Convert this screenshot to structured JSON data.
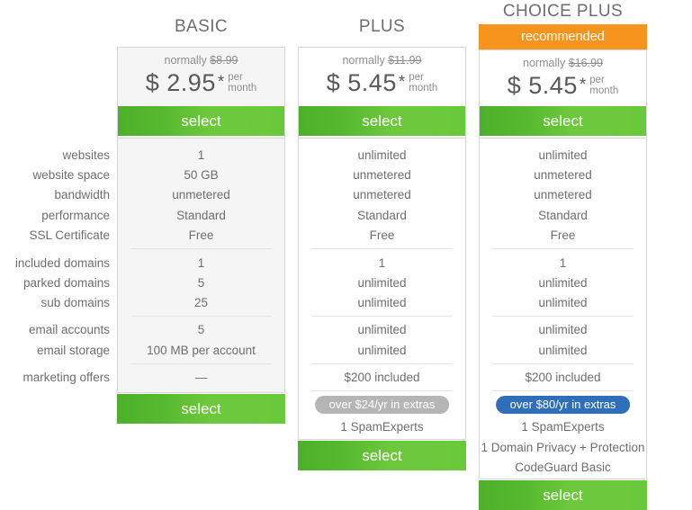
{
  "feature_labels": [
    "websites",
    "website space",
    "bandwidth",
    "performance",
    "SSL Certificate",
    "included domains",
    "parked domains",
    "sub domains",
    "email accounts",
    "email storage",
    "marketing offers"
  ],
  "colors": {
    "green_button": "#5cbf33",
    "recommended_orange": "#f7941e",
    "pill_gray": "#b5b5b5",
    "pill_blue": "#2f6fba",
    "text": "#6d6e71",
    "card_border": "#d5d6d7",
    "basic_background": "#f5f5f5"
  },
  "plans": {
    "basic": {
      "title": "BASIC",
      "ribbon": "",
      "normally_prefix": "normally ",
      "normally_price": "$8.99",
      "price": "$ 2.95",
      "star": "*",
      "per": "per",
      "month": "month",
      "select_label": "select",
      "features": [
        "1",
        "50 GB",
        "unmetered",
        "Standard",
        "Free",
        "1",
        "5",
        "25",
        "5",
        "100 MB per account",
        "—"
      ],
      "extras_pill": "",
      "extras": []
    },
    "plus": {
      "title": "PLUS",
      "ribbon": "",
      "normally_prefix": "normally ",
      "normally_price": "$11.99",
      "price": "$ 5.45",
      "star": "*",
      "per": "per",
      "month": "month",
      "select_label": "select",
      "features": [
        "unlimited",
        "unmetered",
        "unmetered",
        "Standard",
        "Free",
        "1",
        "unlimited",
        "unlimited",
        "unlimited",
        "unlimited",
        "$200 included"
      ],
      "extras_pill": "over $24/yr in extras",
      "extras": [
        "1 SpamExperts"
      ]
    },
    "choice_plus": {
      "title": "CHOICE PLUS",
      "ribbon": "recommended",
      "normally_prefix": "normally ",
      "normally_price": "$16.99",
      "price": "$ 5.45",
      "star": "*",
      "per": "per",
      "month": "month",
      "select_label": "select",
      "features": [
        "unlimited",
        "unmetered",
        "unmetered",
        "Standard",
        "Free",
        "1",
        "unlimited",
        "unlimited",
        "unlimited",
        "unlimited",
        "$200 included"
      ],
      "extras_pill": "over $80/yr in extras",
      "extras": [
        "1 SpamExperts",
        "1 Domain Privacy + Protection",
        "CodeGuard Basic"
      ]
    }
  }
}
